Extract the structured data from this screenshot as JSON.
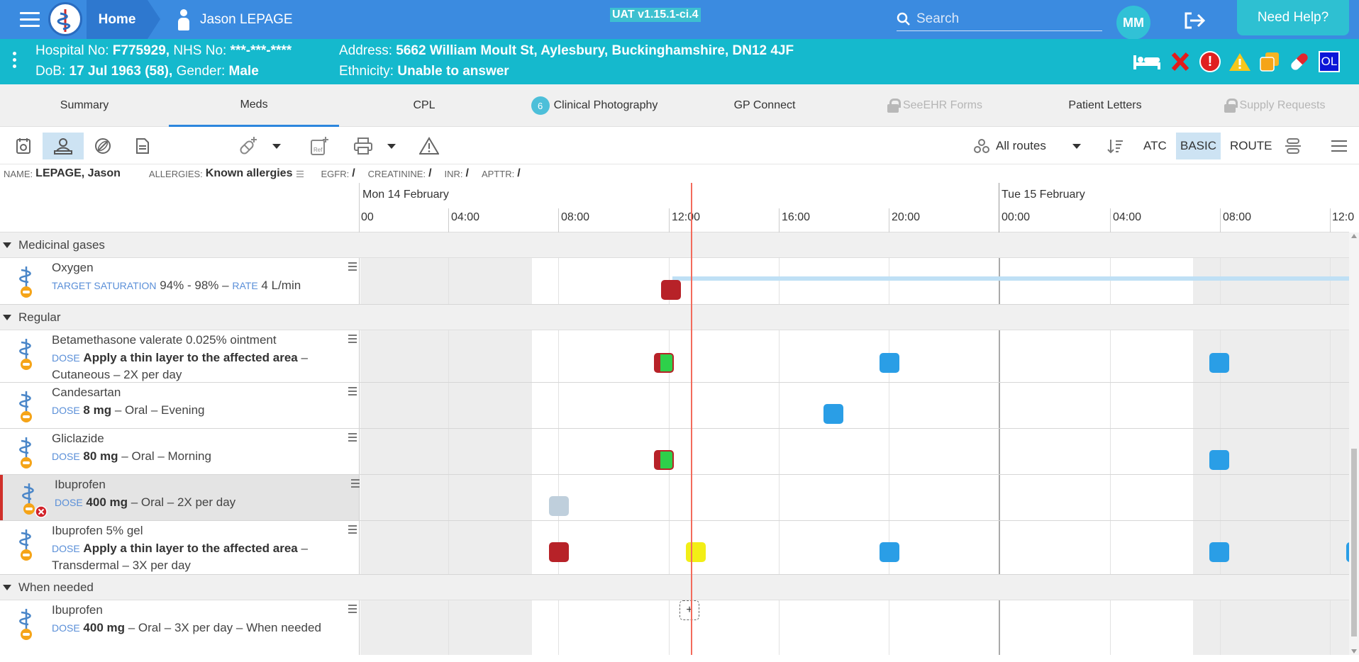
{
  "header": {
    "home_label": "Home",
    "patient_name": "Jason LEPAGE",
    "version": "UAT v1.15.1-ci.4",
    "search_placeholder": "Search",
    "user_initials": "MM",
    "help_label": "Need Help?"
  },
  "banner": {
    "hospital_no_label": "Hospital No:",
    "hospital_no": "F775929,",
    "nhs_no_label": "NHS No:",
    "nhs_no": "***-***-****",
    "dob_label": "DoB:",
    "dob": "17 Jul 1963 (58),",
    "gender_label": "Gender:",
    "gender": "Male",
    "address_label": "Address:",
    "address": "5662 William Moult St, Aylesbury, Buckinghamshire, DN12 4JF",
    "ethnicity_label": "Ethnicity:",
    "ethnicity": "Unable to answer",
    "alert_exclaim": "!",
    "ol_badge": "OL"
  },
  "tabs": [
    {
      "label": "Summary"
    },
    {
      "label": "Meds"
    },
    {
      "label": "CPL"
    },
    {
      "label": "Clinical Photography",
      "count": "6"
    },
    {
      "label": "GP Connect"
    },
    {
      "label": "SeeEHR Forms"
    },
    {
      "label": "Patient Letters"
    },
    {
      "label": "Supply Requests"
    }
  ],
  "toolbar": {
    "routes": "All routes",
    "atc": "ATC",
    "basic": "BASIC",
    "route": "ROUTE"
  },
  "info": {
    "name_label": "NAME:",
    "name": "LEPAGE, Jason",
    "allergies_label": "ALLERGIES:",
    "allergies": "Known allergies",
    "egfr_label": "EGFR:",
    "egfr": "/",
    "creatinine_label": "CREATININE:",
    "creatinine": "/",
    "inr_label": "INR:",
    "inr": "/",
    "apttr_label": "APTTR:",
    "apttr": "/"
  },
  "timeline": {
    "day1": "Mon 14 February",
    "day2": "Tue 15 February",
    "hours": [
      "00",
      "04:00",
      "08:00",
      "12:00",
      "16:00",
      "20:00",
      "00:00",
      "04:00",
      "08:00",
      "12:0"
    ]
  },
  "groups": {
    "gases": "Medicinal gases",
    "regular": "Regular",
    "prn": "When needed"
  },
  "meds": {
    "oxygen": {
      "name": "Oxygen",
      "k1": "TARGET SATURATION",
      "v1": "94% - 98%",
      "sep": "–",
      "k2": "RATE",
      "v2": "4 L/min"
    },
    "betamethasone": {
      "name": "Betamethasone valerate 0.025% ointment",
      "dose_key": "DOSE",
      "dose": "Apply a thin layer to the affected area",
      "rest": "– Cutaneous – 2X per day"
    },
    "candesartan": {
      "name": "Candesartan",
      "dose_key": "DOSE",
      "dose": "8 mg",
      "rest": "– Oral – Evening"
    },
    "gliclazide": {
      "name": "Gliclazide",
      "dose_key": "DOSE",
      "dose": "80 mg",
      "rest": "– Oral – Morning"
    },
    "ibuprofen": {
      "name": "Ibuprofen",
      "dose_key": "DOSE",
      "dose": "400 mg",
      "rest": "– Oral – 2X per day"
    },
    "ibuprofen_gel": {
      "name": "Ibuprofen 5% gel",
      "dose_key": "DOSE",
      "dose": "Apply a thin layer to the affected area",
      "rest": "– Transdermal – 3X per day"
    },
    "ibuprofen_prn": {
      "name": "Ibuprofen",
      "dose_key": "DOSE",
      "dose": "400 mg",
      "rest": "– Oral – 3X per day – When needed"
    },
    "add_label": "+"
  },
  "colors": {
    "header": "#3b8be0",
    "banner": "#15b9cd",
    "missed": "#b72228",
    "scheduled": "#2a9ee6",
    "due": "#f2ee16",
    "given": "#2ed04a",
    "now_line": "#f36b5c"
  },
  "icons": [
    "menu-icon",
    "logo-icon",
    "person-icon",
    "search-icon",
    "logout-icon",
    "bed-icon",
    "red-x-icon",
    "alert-icon",
    "warning-icon",
    "copy-icon",
    "pill-icon"
  ]
}
